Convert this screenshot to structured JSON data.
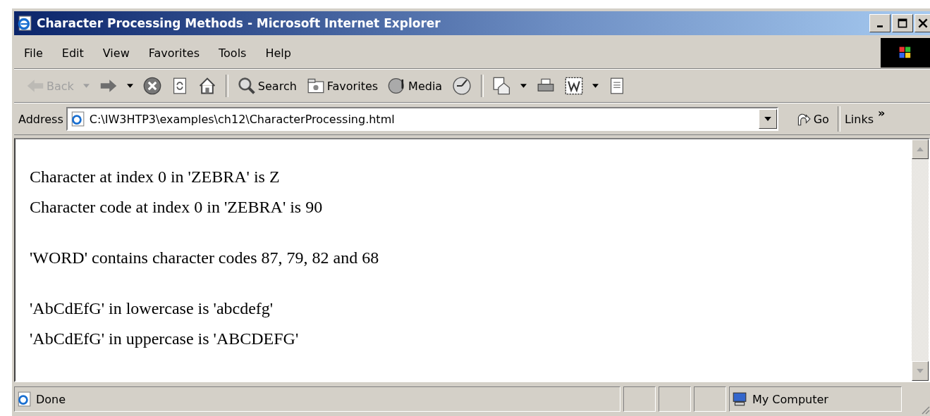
{
  "window": {
    "title": "Character Processing Methods - Microsoft Internet Explorer"
  },
  "menu": [
    "File",
    "Edit",
    "View",
    "Favorites",
    "Tools",
    "Help"
  ],
  "toolbar": [
    {
      "kind": "back",
      "label": "Back",
      "disabled": true
    },
    {
      "kind": "forward",
      "disabled": false
    },
    {
      "kind": "stop",
      "disabled": false
    },
    {
      "kind": "refresh",
      "disabled": false
    },
    {
      "kind": "home",
      "disabled": false
    },
    {
      "kind": "separator"
    },
    {
      "kind": "search",
      "label": "Search",
      "disabled": false
    },
    {
      "kind": "favorites",
      "label": "Favorites",
      "disabled": false
    },
    {
      "kind": "media",
      "label": "Media",
      "disabled": false
    },
    {
      "kind": "history",
      "disabled": false
    },
    {
      "kind": "separator"
    },
    {
      "kind": "mail",
      "disabled": false
    },
    {
      "kind": "print",
      "disabled": false
    },
    {
      "kind": "edit",
      "disabled": false
    },
    {
      "kind": "discuss",
      "disabled": false
    }
  ],
  "address": {
    "label": "Address",
    "value": "C:\\IW3HTP3\\examples\\ch12\\CharacterProcessing.html",
    "go": "Go",
    "links": "Links",
    "more": "»"
  },
  "content": [
    [
      "Character at index 0 in 'ZEBRA' is Z",
      "Character code at index 0 in 'ZEBRA' is 90"
    ],
    [
      "'WORD' contains character codes 87, 79, 82 and 68"
    ],
    [
      "'AbCdEfG' in lowercase is 'abcdefg'",
      "'AbCdEfG' in uppercase is 'ABCDEFG'"
    ]
  ],
  "status_bar": {
    "text": "Done",
    "zone": "My Computer"
  }
}
